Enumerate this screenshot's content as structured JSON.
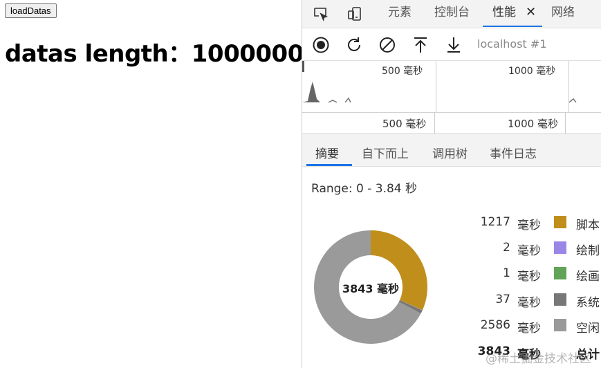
{
  "page": {
    "button_label": "loadDatas",
    "heading": "datas length：1000000"
  },
  "devtools": {
    "tabs": [
      {
        "label": "元素"
      },
      {
        "label": "控制台"
      },
      {
        "label": "性能",
        "active": true
      },
      {
        "label": "网络"
      }
    ],
    "close_glyph": "✕",
    "toolbar": {
      "icons": [
        "record-icon",
        "reload-icon",
        "clear-icon",
        "upload-icon",
        "download-icon"
      ],
      "target": "localhost #1"
    },
    "overview_labels": [
      "500 毫秒",
      "1000 毫秒"
    ],
    "ruler_labels": [
      "500 毫秒",
      "1000 毫秒"
    ],
    "subtabs": [
      {
        "label": "摘要",
        "active": true
      },
      {
        "label": "自下而上"
      },
      {
        "label": "调用树"
      },
      {
        "label": "事件日志"
      }
    ],
    "summary": {
      "range": "Range: 0 - 3.84 秒",
      "center_label": "3843 毫秒",
      "unit": "毫秒",
      "rows": [
        {
          "value": "1217",
          "name": "脚本",
          "color": "#c08f1b"
        },
        {
          "value": "2",
          "name": "绘制",
          "color": "#9b86e8"
        },
        {
          "value": "1",
          "name": "绘画",
          "color": "#62a457"
        },
        {
          "value": "37",
          "name": "系统",
          "color": "#777777"
        },
        {
          "value": "2586",
          "name": "空闲",
          "color": "#9a9a9a"
        }
      ],
      "total": {
        "value": "3843",
        "name": "总计"
      }
    }
  },
  "watermark": "@稀土掘金技术社区",
  "chart_data": {
    "type": "pie",
    "categories": [
      "脚本",
      "绘制",
      "绘画",
      "系统",
      "空闲"
    ],
    "values": [
      1217,
      2,
      1,
      37,
      2586
    ],
    "colors": [
      "#c08f1b",
      "#9b86e8",
      "#62a457",
      "#777777",
      "#9a9a9a"
    ],
    "title": "",
    "center_label": "3843 毫秒"
  }
}
